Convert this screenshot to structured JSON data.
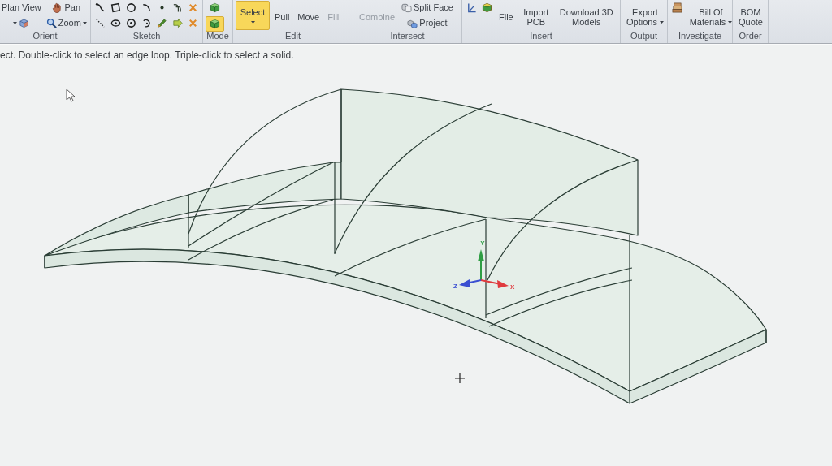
{
  "ribbon": {
    "groups": [
      {
        "label": "Orient",
        "stacks": [
          [
            {
              "kind": "text",
              "label": "Plan View",
              "selected": false,
              "disabled": false,
              "dropdown": false
            },
            {
              "kind": "icon",
              "selected": false,
              "disabled": false,
              "dropdown": true
            }
          ],
          [
            {
              "kind": "icon-label",
              "label": "Pan",
              "selected": false,
              "disabled": false,
              "dropdown": false
            },
            {
              "kind": "icon-label",
              "label": "Zoom",
              "selected": false,
              "disabled": false,
              "dropdown": true
            }
          ]
        ]
      },
      {
        "label": "Sketch",
        "stacks": [
          [
            {
              "kind": "icon",
              "selected": false,
              "disabled": false,
              "dropdown": false
            },
            {
              "kind": "icon",
              "selected": false,
              "disabled": false,
              "dropdown": false
            }
          ],
          [
            {
              "kind": "icon",
              "selected": false,
              "disabled": false,
              "dropdown": false
            },
            {
              "kind": "icon",
              "selected": false,
              "disabled": false,
              "dropdown": false
            }
          ],
          [
            {
              "kind": "icon",
              "selected": false,
              "disabled": false,
              "dropdown": false
            },
            {
              "kind": "icon",
              "selected": false,
              "disabled": false,
              "dropdown": false
            }
          ],
          [
            {
              "kind": "icon",
              "selected": false,
              "disabled": false,
              "dropdown": false
            },
            {
              "kind": "icon",
              "selected": false,
              "disabled": false,
              "dropdown": false
            }
          ],
          [
            {
              "kind": "icon",
              "selected": false,
              "disabled": false,
              "dropdown": false
            },
            {
              "kind": "icon",
              "selected": false,
              "disabled": false,
              "dropdown": false
            }
          ],
          [
            {
              "kind": "icon",
              "selected": false,
              "disabled": false,
              "dropdown": false
            },
            {
              "kind": "icon",
              "selected": false,
              "disabled": false,
              "dropdown": false
            }
          ],
          [
            {
              "kind": "icon",
              "selected": false,
              "disabled": false,
              "dropdown": false
            },
            {
              "kind": "icon",
              "selected": false,
              "disabled": false,
              "dropdown": false
            }
          ]
        ]
      },
      {
        "label": "Mode",
        "stacks": [
          [
            {
              "kind": "icon",
              "selected": false,
              "disabled": false,
              "dropdown": false
            },
            {
              "kind": "icon",
              "selected": true,
              "disabled": false,
              "dropdown": false
            }
          ]
        ]
      },
      {
        "label": "Edit",
        "stacks": [
          [
            {
              "kind": "label",
              "label": "Select",
              "selected": true,
              "disabled": false,
              "dropdown": true
            }
          ],
          [
            {
              "kind": "label",
              "label": "Pull",
              "selected": false,
              "disabled": false,
              "dropdown": false
            }
          ],
          [
            {
              "kind": "label",
              "label": "Move",
              "selected": false,
              "disabled": false,
              "dropdown": false
            }
          ],
          [
            {
              "kind": "label",
              "label": "Fill",
              "selected": false,
              "disabled": true,
              "dropdown": false
            }
          ]
        ]
      },
      {
        "label": "Intersect",
        "stacks": [
          [
            {
              "kind": "label",
              "label": "Combine",
              "selected": false,
              "disabled": true,
              "dropdown": false
            }
          ],
          [
            {
              "kind": "icon-label",
              "label": "Split Face",
              "selected": false,
              "disabled": false,
              "dropdown": false
            },
            {
              "kind": "icon-label",
              "label": "Project",
              "selected": false,
              "disabled": false,
              "dropdown": false
            }
          ]
        ]
      },
      {
        "label": "Insert",
        "stacks": [
          [
            {
              "kind": "icon",
              "selected": false,
              "disabled": false,
              "dropdown": false
            }
          ],
          [
            {
              "kind": "icon",
              "selected": false,
              "disabled": false,
              "dropdown": false
            }
          ],
          [
            {
              "kind": "label",
              "label": "File",
              "selected": false,
              "disabled": false,
              "dropdown": false
            }
          ],
          [
            {
              "kind": "label",
              "label": "Import PCB",
              "selected": false,
              "disabled": false,
              "dropdown": false
            }
          ],
          [
            {
              "kind": "label",
              "label": "Download 3D Models",
              "selected": false,
              "disabled": false,
              "dropdown": false
            }
          ]
        ]
      },
      {
        "label": "Output",
        "stacks": [
          [
            {
              "kind": "label",
              "label": "Export Options",
              "selected": false,
              "disabled": false,
              "dropdown": true
            }
          ]
        ]
      },
      {
        "label": "Investigate",
        "stacks": [
          [
            {
              "kind": "icon",
              "selected": false,
              "disabled": false,
              "dropdown": false
            }
          ],
          [
            {
              "kind": "label",
              "label": "Bill Of Materials",
              "selected": false,
              "disabled": false,
              "dropdown": true
            }
          ]
        ]
      },
      {
        "label": "Order",
        "stacks": [
          [
            {
              "kind": "label",
              "label": "BOM Quote",
              "selected": false,
              "disabled": false,
              "dropdown": false
            }
          ]
        ]
      }
    ]
  },
  "hint": "ect. Double-click to select an edge loop. Triple-click to select a solid.",
  "viewport": {
    "triad": {
      "axes": [
        {
          "label": "Y",
          "color": "#2f9e44"
        },
        {
          "label": "X",
          "color": "#e03a3e"
        },
        {
          "label": "Z",
          "color": "#3b4fd1"
        }
      ]
    }
  }
}
